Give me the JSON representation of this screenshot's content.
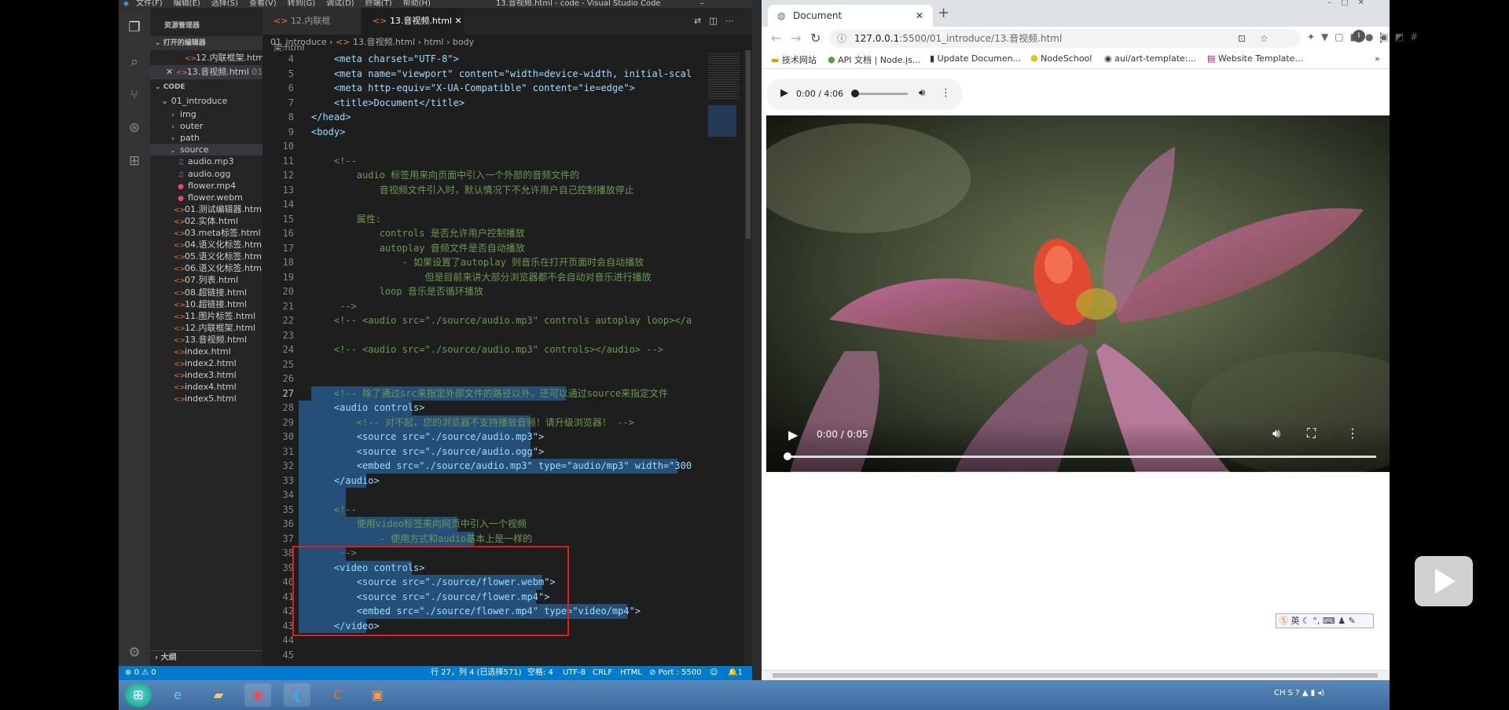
{
  "vscode": {
    "title": "13.音视频.html - code - Visual Studio Code",
    "menu": [
      "文件(F)",
      "编辑(E)",
      "选择(S)",
      "查看(V)",
      "转到(G)",
      "调试(D)",
      "终端(T)",
      "帮助(H)"
    ],
    "sidebar_title": "资源管理器",
    "open_editors_label": "打开的编辑器",
    "open_editors": [
      "12.内联框架.html",
      "13.音视频.html"
    ],
    "open_editor_path_hint": "01",
    "workspace_label": "CODE",
    "folder": "01_introduce",
    "tree": [
      "img",
      "outer",
      "path",
      "source",
      "audio.mp3",
      "audio.ogg",
      "flower.mp4",
      "flower.webm",
      "01.测试编辑器.html",
      "02.实体.html",
      "03.meta标签.html",
      "04.语义化标签.html",
      "05.语义化标签.html",
      "06.语义化标签.html",
      "07.列表.html",
      "08.超链接.html",
      "10.超链接.html",
      "11.图片标签.html",
      "12.内联框架.html",
      "13.音视频.html",
      "index.html",
      "index2.html",
      "index3.html",
      "index4.html",
      "index5.html"
    ],
    "outline_label": "大纲",
    "tabs": [
      "12.内联框架.html",
      "13.音视频.html"
    ],
    "breadcrumb": [
      "01_introduce",
      "13.音视频.html",
      "html",
      "body"
    ],
    "line_numbers": [
      "4",
      "5",
      "6",
      "7",
      "8",
      "9",
      "10",
      "11",
      "12",
      "13",
      "14",
      "15",
      "16",
      "17",
      "18",
      "19",
      "20",
      "21",
      "22",
      "23",
      "24",
      "25",
      "26",
      "27",
      "28",
      "29",
      "30",
      "31",
      "32",
      "33",
      "34",
      "35",
      "36",
      "37",
      "38",
      "39",
      "40",
      "41",
      "42",
      "43",
      "44",
      "45"
    ],
    "code_lines": [
      "    <meta charset=\"UTF-8\">",
      "    <meta name=\"viewport\" content=\"width=device-width, initial-scal",
      "    <meta http-equiv=\"X-UA-Compatible\" content=\"ie=edge\">",
      "    <title>Document</title>",
      "</head>",
      "<body>",
      "",
      "    <!--",
      "        audio 标签用来向页面中引入一个外部的音频文件的",
      "            音视频文件引入时，默认情况下不允许用户自己控制播放停止",
      "",
      "        属性:",
      "            controls 是否允许用户控制播放",
      "            autoplay 音频文件是否自动播放",
      "                - 如果设置了autoplay 则音乐在打开页面时会自动播放",
      "                    但是目前来讲大部分浏览器都不会自动对音乐进行播放",
      "            loop 音乐是否循环播放",
      "     -->",
      "    <!-- <audio src=\"./source/audio.mp3\" controls autoplay loop></a",
      "",
      "    <!-- <audio src=\"./source/audio.mp3\" controls></audio> -->",
      "",
      "",
      "    <!-- 除了通过src来指定外部文件的路径以外，还可以通过source来指定文件",
      "    <audio controls>",
      "        <!-- 对不起，您的浏览器不支持播放音频！请升级浏览器！ -->",
      "        <source src=\"./source/audio.mp3\">",
      "        <source src=\"./source/audio.ogg\">",
      "        <embed src=\"./source/audio.mp3\" type=\"audio/mp3\" width=\"300",
      "    </audio>",
      "",
      "    <!--",
      "        使用video标签来向网页中引入一个视频",
      "            - 使用方式和audio基本上是一样的",
      "     -->",
      "    <video controls>",
      "        <source src=\"./source/flower.webm\">",
      "        <source src=\"./source/flower.mp4\">",
      "        <embed src=\"./source/flower.mp4\" type=\"video/mp4\">",
      "    </video>",
      "",
      ""
    ],
    "status": {
      "errors": "0",
      "warnings": "0",
      "position": "行 27，列 4 (已选择571)",
      "spaces": "空格: 4",
      "encoding": "UTF-8",
      "eol": "CRLF",
      "lang": "HTML",
      "port": "Port : 5500",
      "bell": "1"
    }
  },
  "chrome": {
    "tab_title": "Document",
    "url": "127.0.0.1:5500/01_introduce/13.音视频.html",
    "url_host": "127.0.0.1",
    "url_rest": ":5500/01_introduce/13.音视频.html",
    "bookmarks": [
      "技术网站",
      "API 文档 | Node.js...",
      "Update Documen...",
      "NodeSchool",
      "aui/art-template:...",
      "Website Template..."
    ],
    "audio_time": "0:00 / 4:06",
    "video_time": "0:00 / 0:05",
    "ime": "英"
  }
}
